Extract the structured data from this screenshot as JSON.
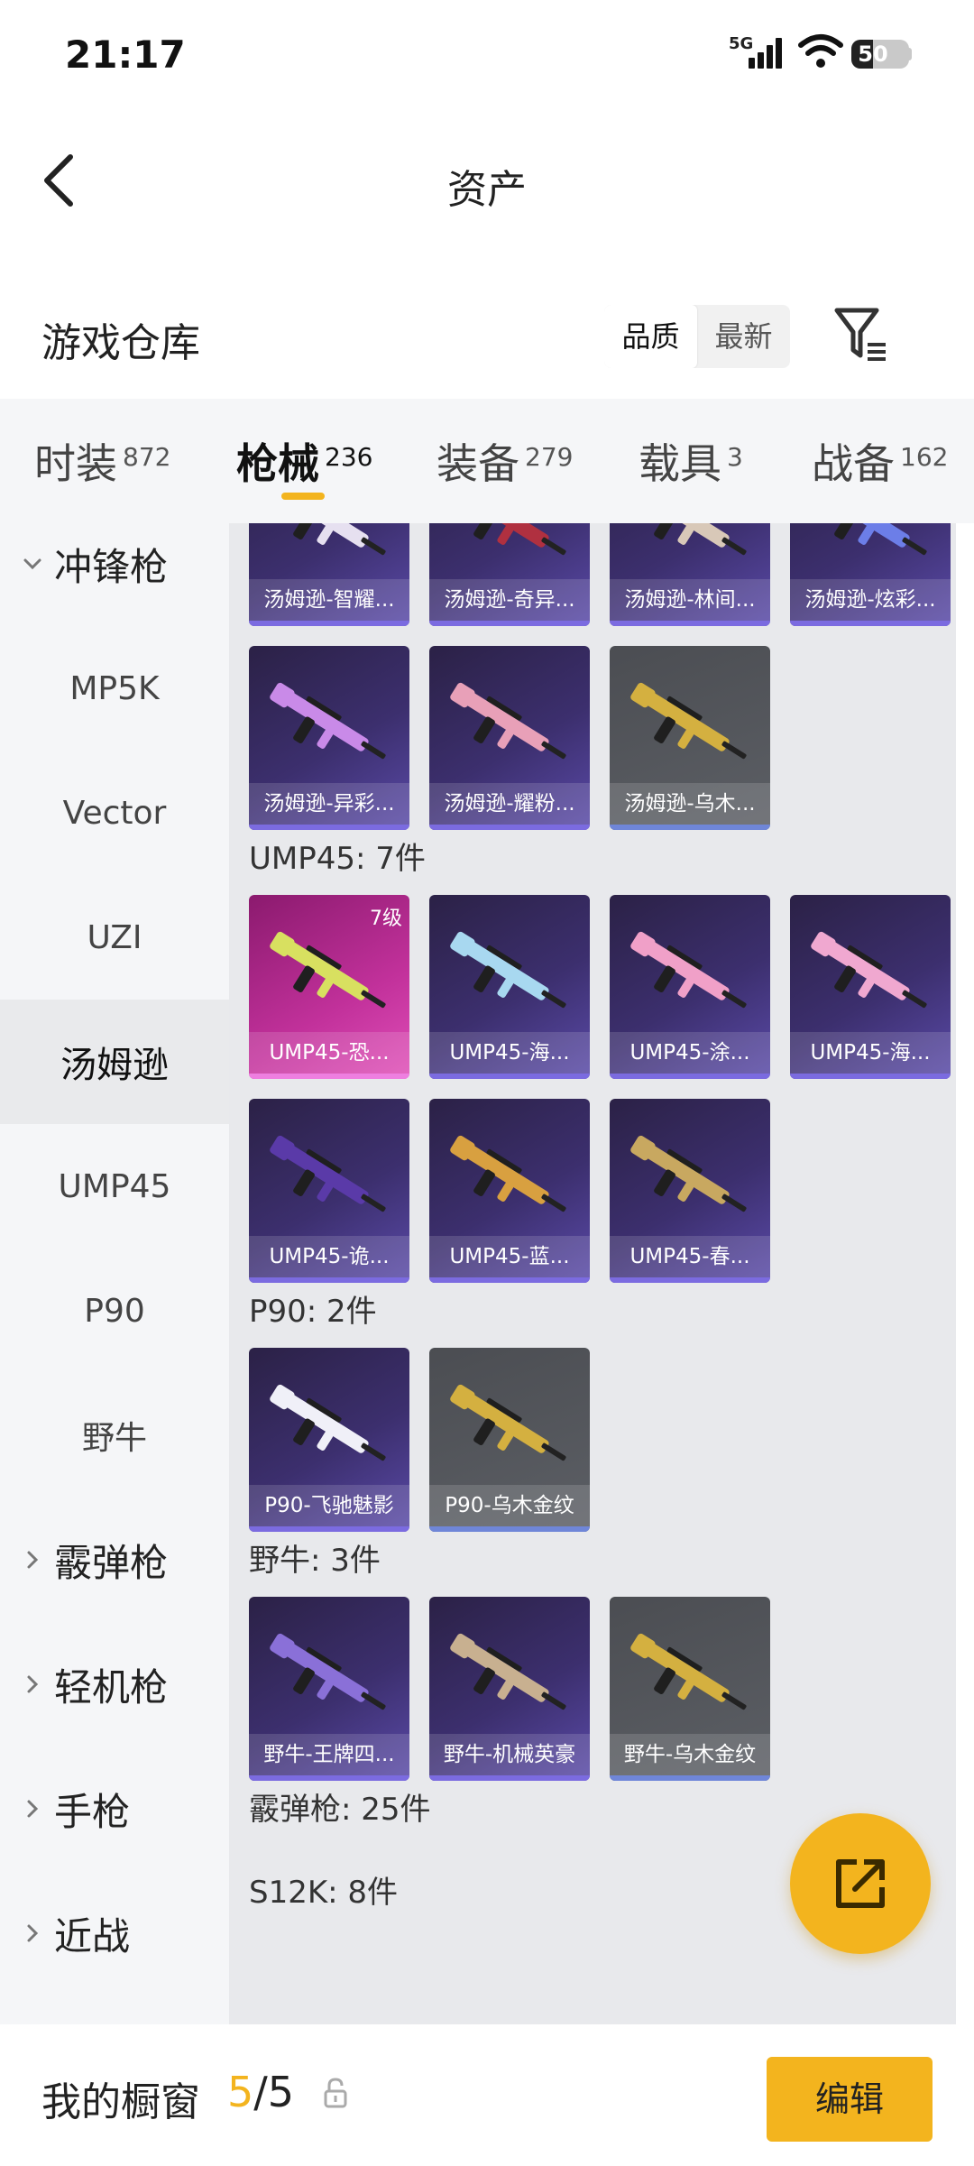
{
  "status_bar": {
    "time": "21:17",
    "network": "5G",
    "battery": "50",
    "battery_level": 0.5
  },
  "nav": {
    "title": "资产"
  },
  "warehouse": {
    "title": "游戏仓库",
    "sort_options": [
      "品质",
      "最新"
    ],
    "active_sort": "品质"
  },
  "tabs": [
    {
      "label": "时装",
      "count": "872"
    },
    {
      "label": "枪械",
      "count": "236",
      "active": true
    },
    {
      "label": "装备",
      "count": "279"
    },
    {
      "label": "载具",
      "count": "3"
    },
    {
      "label": "战备",
      "count": "162"
    }
  ],
  "sidebar": [
    {
      "label": "冲锋枪",
      "type": "category",
      "expanded": true
    },
    {
      "label": "MP5K",
      "type": "sub"
    },
    {
      "label": "Vector",
      "type": "sub"
    },
    {
      "label": "UZI",
      "type": "sub"
    },
    {
      "label": "汤姆逊",
      "type": "sub",
      "selected": true
    },
    {
      "label": "UMP45",
      "type": "sub"
    },
    {
      "label": "P90",
      "type": "sub"
    },
    {
      "label": "野牛",
      "type": "sub"
    },
    {
      "label": "霰弹枪",
      "type": "category"
    },
    {
      "label": "轻机枪",
      "type": "category"
    },
    {
      "label": "手枪",
      "type": "category"
    },
    {
      "label": "近战",
      "type": "category"
    }
  ],
  "content": {
    "tommy_rows": [
      [
        {
          "name": "汤姆逊-智耀...",
          "style": "purple",
          "gun": "#e6e0f0"
        },
        {
          "name": "汤姆逊-奇异...",
          "style": "purple",
          "gun": "#b03040"
        },
        {
          "name": "汤姆逊-林间...",
          "style": "purple",
          "gun": "#d8c8b8"
        },
        {
          "name": "汤姆逊-炫彩...",
          "style": "purple",
          "gun": "#6c7ee8"
        }
      ],
      [
        {
          "name": "汤姆逊-异彩...",
          "style": "purple",
          "gun": "#c98ae8"
        },
        {
          "name": "汤姆逊-耀粉...",
          "style": "purple",
          "gun": "#e8a0b8"
        },
        {
          "name": "汤姆逊-乌木...",
          "style": "gray",
          "gun": "#d4b040"
        }
      ]
    ],
    "groups": [
      {
        "label": "UMP45: 7件",
        "rows": [
          [
            {
              "name": "UMP45-恐...",
              "style": "pink",
              "level": "7级",
              "gun": "#d8e060"
            },
            {
              "name": "UMP45-海...",
              "style": "purple",
              "gun": "#a8d8f0"
            },
            {
              "name": "UMP45-涂...",
              "style": "purple",
              "gun": "#f0a0c8"
            },
            {
              "name": "UMP45-海...",
              "style": "purple",
              "gun": "#f0a8d0"
            }
          ],
          [
            {
              "name": "UMP45-诡...",
              "style": "purple",
              "gun": "#5a3aa8"
            },
            {
              "name": "UMP45-蓝...",
              "style": "purple",
              "gun": "#d8a040"
            },
            {
              "name": "UMP45-春...",
              "style": "purple",
              "gun": "#c8a860"
            }
          ]
        ]
      },
      {
        "label": "P90: 2件",
        "rows": [
          [
            {
              "name": "P90-飞驰魅影",
              "style": "purple",
              "gun": "#f0f0f8"
            },
            {
              "name": "P90-乌木金纹",
              "style": "gray",
              "gun": "#d4b040"
            }
          ]
        ]
      },
      {
        "label": "野牛: 3件",
        "rows": [
          [
            {
              "name": "野牛-王牌四...",
              "style": "purple",
              "gun": "#8a70d8"
            },
            {
              "name": "野牛-机械英豪",
              "style": "purple",
              "gun": "#c8b090"
            },
            {
              "name": "野牛-乌木金纹",
              "style": "gray",
              "gun": "#d4b040"
            }
          ]
        ]
      },
      {
        "label": "霰弹枪: 25件",
        "rows": []
      },
      {
        "label": "S12K: 8件",
        "rows": []
      }
    ]
  },
  "bottom": {
    "label": "我的橱窗",
    "count_current": "5",
    "count_sep": "/",
    "count_max": "5",
    "edit_label": "编辑"
  },
  "colors": {
    "accent": "#f3b41e",
    "card_purple": "#3c2f6e",
    "card_gray": "#5c5f65",
    "card_pink": "#c2319b"
  },
  "icons": {
    "back": "chevron-left-icon",
    "filter": "filter-icon",
    "fab": "share-external-icon",
    "lock": "lock-icon"
  }
}
